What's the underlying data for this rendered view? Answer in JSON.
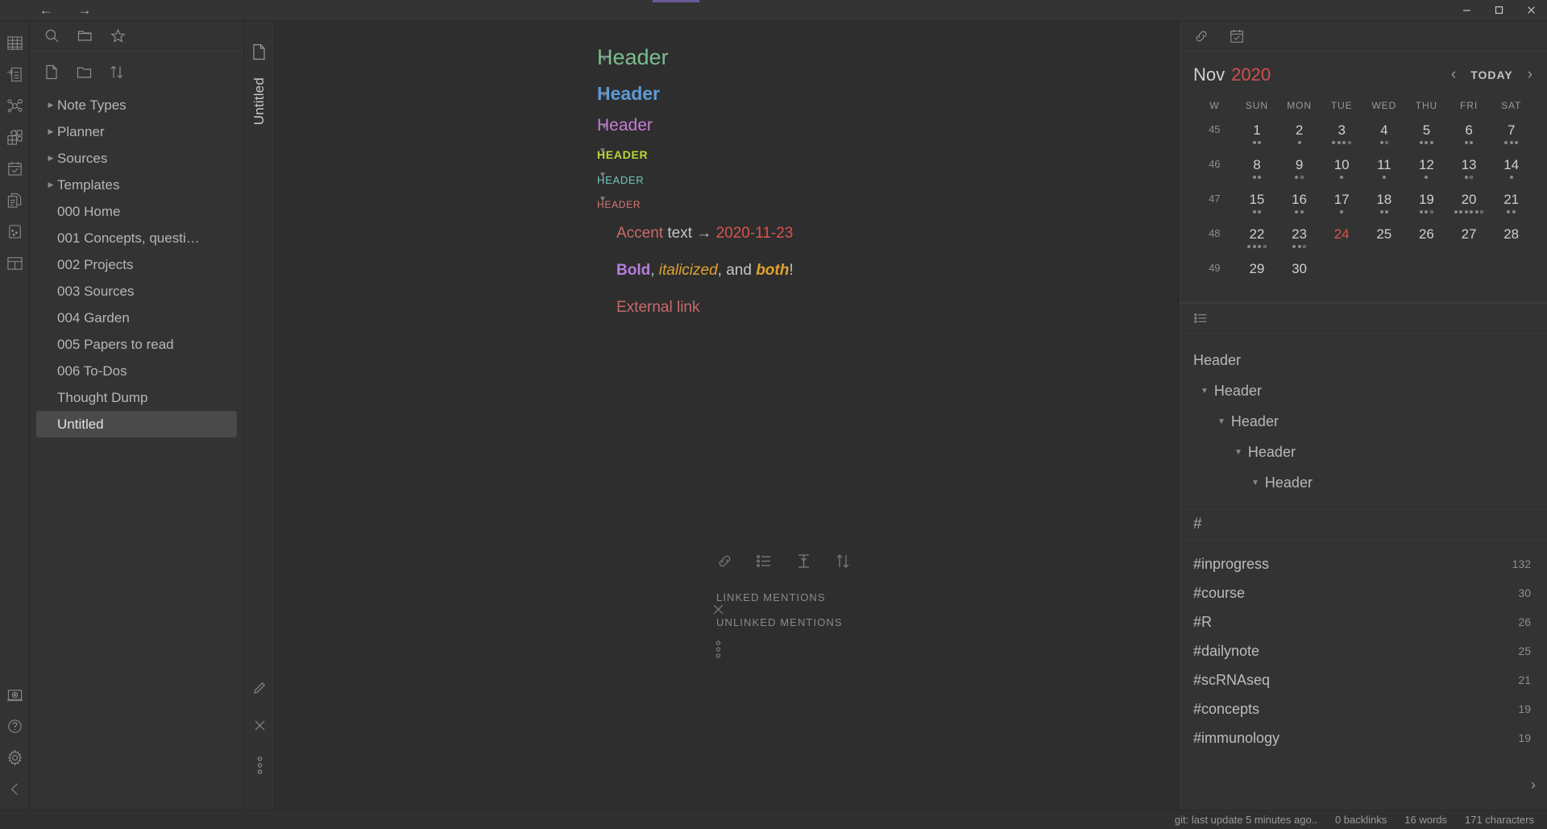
{
  "titlebar": {
    "back_label": "←",
    "forward_label": "→",
    "minimize_label": "minimize",
    "maximize_label": "maximize",
    "close_label": "close",
    "accent_color": "#6a5a96"
  },
  "rail": {
    "items": [
      {
        "name": "table-icon"
      },
      {
        "name": "outline-import-icon"
      },
      {
        "name": "graph-icon"
      },
      {
        "name": "kanban-grid-icon"
      },
      {
        "name": "calendar-check-icon"
      },
      {
        "name": "documents-icon"
      },
      {
        "name": "card-icon"
      },
      {
        "name": "layout-icon"
      }
    ],
    "bottom_items": [
      {
        "name": "screenshot-icon"
      },
      {
        "name": "help-icon"
      },
      {
        "name": "settings-gear-icon"
      },
      {
        "name": "collapse-left-icon"
      }
    ]
  },
  "explorer": {
    "toolbar_top": [
      {
        "name": "search-icon"
      },
      {
        "name": "folder-open-icon"
      },
      {
        "name": "star-icon"
      }
    ],
    "toolbar_bottom": [
      {
        "name": "new-file-icon"
      },
      {
        "name": "new-folder-icon"
      },
      {
        "name": "sort-icon"
      }
    ],
    "items": [
      {
        "label": "Note Types",
        "folder": true,
        "selected": false
      },
      {
        "label": "Planner",
        "folder": true,
        "selected": false
      },
      {
        "label": "Sources",
        "folder": true,
        "selected": false
      },
      {
        "label": "Templates",
        "folder": true,
        "selected": false
      },
      {
        "label": "000 Home",
        "folder": false,
        "selected": false
      },
      {
        "label": "001 Concepts, questi…",
        "folder": false,
        "selected": false
      },
      {
        "label": "002 Projects",
        "folder": false,
        "selected": false
      },
      {
        "label": "003 Sources",
        "folder": false,
        "selected": false
      },
      {
        "label": "004 Garden",
        "folder": false,
        "selected": false
      },
      {
        "label": "005 Papers to read",
        "folder": false,
        "selected": false
      },
      {
        "label": "006 To-Dos",
        "folder": false,
        "selected": false
      },
      {
        "label": "Thought Dump",
        "folder": false,
        "selected": false
      },
      {
        "label": "Untitled",
        "folder": false,
        "selected": true
      }
    ]
  },
  "tabstrip": {
    "tab_label": "Untitled",
    "doc_icon": "file-icon",
    "bottom_icons": [
      {
        "name": "pencil-icon"
      },
      {
        "name": "close-icon"
      },
      {
        "name": "more-vertical-icon"
      }
    ]
  },
  "editor": {
    "headings": [
      {
        "level": 1,
        "text": "Header",
        "color": "#7bbd8f"
      },
      {
        "level": 2,
        "text": "Header",
        "color": "#5b9bd8"
      },
      {
        "level": 3,
        "text": "Header",
        "color": "#c87bd8"
      },
      {
        "level": 4,
        "text": "HEADER",
        "color": "#b8d838"
      },
      {
        "level": 5,
        "text": "HEADER",
        "color": "#6fc8b8"
      },
      {
        "level": 6,
        "text": "HEADER",
        "color": "#d97a72"
      }
    ],
    "accent_line": {
      "accent_word": "Accent",
      "middle": " text → ",
      "date_link": "2020-11-23"
    },
    "format_line": {
      "bold": "Bold",
      "sep1": ", ",
      "italic": "italicized",
      "sep2": ", and ",
      "both": "both",
      "end": "!"
    },
    "external_link": "External link",
    "mentions": {
      "icons": [
        {
          "name": "link-icon"
        },
        {
          "name": "list-icon"
        },
        {
          "name": "collapse-vertical-icon"
        },
        {
          "name": "sort-icon"
        }
      ],
      "linked": "LINKED MENTIONS",
      "unlinked": "UNLINKED MENTIONS"
    },
    "left_handles": [
      {
        "name": "close-icon"
      },
      {
        "name": "more-vertical-icon"
      }
    ]
  },
  "right_sidebar": {
    "toolbar": [
      {
        "name": "link-icon"
      },
      {
        "name": "calendar-check-icon"
      }
    ],
    "calendar": {
      "month": "Nov",
      "year": "2020",
      "today_label": "TODAY",
      "prev_label": "‹",
      "next_label": "›",
      "weekday_headers": [
        "W",
        "SUN",
        "MON",
        "TUE",
        "WED",
        "THU",
        "FRI",
        "SAT"
      ],
      "weeks": [
        {
          "w": "45",
          "days": [
            {
              "n": "1",
              "filled": 2,
              "open": 0
            },
            {
              "n": "2",
              "filled": 1,
              "open": 0
            },
            {
              "n": "3",
              "filled": 3,
              "open": 1
            },
            {
              "n": "4",
              "filled": 1,
              "open": 1
            },
            {
              "n": "5",
              "filled": 3,
              "open": 0
            },
            {
              "n": "6",
              "filled": 2,
              "open": 0
            },
            {
              "n": "7",
              "filled": 3,
              "open": 0
            }
          ]
        },
        {
          "w": "46",
          "days": [
            {
              "n": "8",
              "filled": 2,
              "open": 0
            },
            {
              "n": "9",
              "filled": 1,
              "open": 1
            },
            {
              "n": "10",
              "filled": 1,
              "open": 0
            },
            {
              "n": "11",
              "filled": 1,
              "open": 0
            },
            {
              "n": "12",
              "filled": 1,
              "open": 0
            },
            {
              "n": "13",
              "filled": 1,
              "open": 1
            },
            {
              "n": "14",
              "filled": 1,
              "open": 0
            }
          ]
        },
        {
          "w": "47",
          "days": [
            {
              "n": "15",
              "filled": 2,
              "open": 0
            },
            {
              "n": "16",
              "filled": 2,
              "open": 0
            },
            {
              "n": "17",
              "filled": 1,
              "open": 0
            },
            {
              "n": "18",
              "filled": 2,
              "open": 0
            },
            {
              "n": "19",
              "filled": 2,
              "open": 1
            },
            {
              "n": "20",
              "filled": 5,
              "open": 1
            },
            {
              "n": "21",
              "filled": 2,
              "open": 0
            }
          ]
        },
        {
          "w": "48",
          "days": [
            {
              "n": "22",
              "filled": 3,
              "open": 1
            },
            {
              "n": "23",
              "filled": 2,
              "open": 1
            },
            {
              "n": "24",
              "filled": 0,
              "open": 0,
              "today": true
            },
            {
              "n": "25",
              "filled": 0,
              "open": 0
            },
            {
              "n": "26",
              "filled": 0,
              "open": 0
            },
            {
              "n": "27",
              "filled": 0,
              "open": 0
            },
            {
              "n": "28",
              "filled": 0,
              "open": 0
            }
          ]
        },
        {
          "w": "49",
          "days": [
            {
              "n": "29",
              "filled": 0,
              "open": 0
            },
            {
              "n": "30",
              "filled": 0,
              "open": 0
            },
            {
              "n": "",
              "filled": 0,
              "open": 0
            },
            {
              "n": "",
              "filled": 0,
              "open": 0
            },
            {
              "n": "",
              "filled": 0,
              "open": 0
            },
            {
              "n": "",
              "filled": 0,
              "open": 0
            },
            {
              "n": "",
              "filled": 0,
              "open": 0
            }
          ]
        }
      ]
    },
    "outline": {
      "header_icon": "outline-list-icon",
      "items": [
        {
          "text": "Header",
          "depth": 0,
          "caret": false
        },
        {
          "text": "Header",
          "depth": 1,
          "caret": true
        },
        {
          "text": "Header",
          "depth": 2,
          "caret": true
        },
        {
          "text": "Header",
          "depth": 3,
          "caret": true
        },
        {
          "text": "Header",
          "depth": 4,
          "caret": true
        }
      ]
    },
    "tags": {
      "header_symbol": "#",
      "items": [
        {
          "name": "#inprogress",
          "count": "132"
        },
        {
          "name": "#course",
          "count": "30"
        },
        {
          "name": "#R",
          "count": "26"
        },
        {
          "name": "#dailynote",
          "count": "25"
        },
        {
          "name": "#scRNAseq",
          "count": "21"
        },
        {
          "name": "#concepts",
          "count": "19"
        },
        {
          "name": "#immunology",
          "count": "19"
        }
      ],
      "more_label": "›"
    }
  },
  "statusbar": {
    "git": "git: last update 5 minutes ago..",
    "backlinks": "0 backlinks",
    "words": "16 words",
    "characters": "171 characters"
  }
}
